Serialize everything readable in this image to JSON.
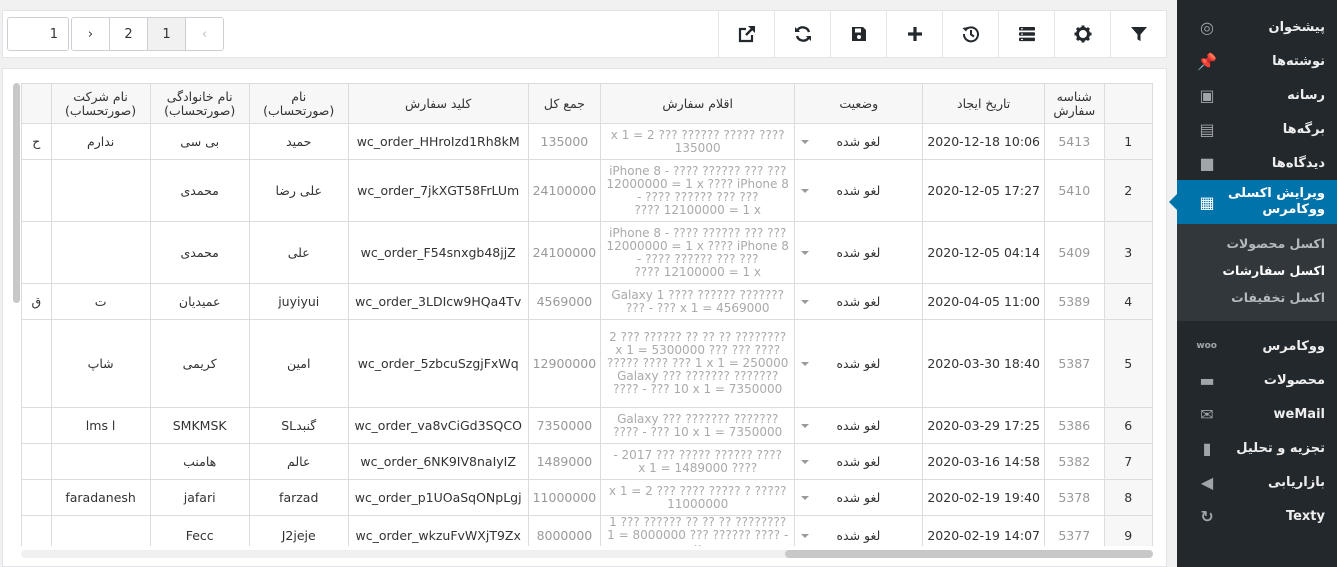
{
  "sidebar": {
    "items": [
      {
        "label": "پیشخوان",
        "icon": "dashboard-icon",
        "glyph": "◎"
      },
      {
        "label": "نوشته‌ها",
        "icon": "pin-icon",
        "glyph": "📌"
      },
      {
        "label": "رسانه",
        "icon": "media-icon",
        "glyph": "▣"
      },
      {
        "label": "برگه‌ها",
        "icon": "pages-icon",
        "glyph": "▤"
      },
      {
        "label": "دیدگاه‌ها",
        "icon": "comments-icon",
        "glyph": "■"
      },
      {
        "label": "ویرایش اکسلی ووکامرس",
        "icon": "document-icon",
        "glyph": "▦"
      }
    ],
    "submenu": [
      "اکسل محصولات",
      "اکسل سفارشات",
      "اکسل تخفیفات"
    ],
    "items2": [
      {
        "label": "ووکامرس",
        "icon": "woo-icon",
        "glyph": "woo"
      },
      {
        "label": "محصولات",
        "icon": "archive-icon",
        "glyph": "▬"
      },
      {
        "label": "weMail",
        "icon": "mail-icon",
        "glyph": "✉"
      },
      {
        "label": "تجزیه و تحلیل",
        "icon": "chart-icon",
        "glyph": "▮"
      },
      {
        "label": "بازاریابی",
        "icon": "megaphone-icon",
        "glyph": "◀"
      },
      {
        "label": "Texty",
        "icon": "texty-icon",
        "glyph": "↻"
      }
    ]
  },
  "pager": {
    "page_input": "1",
    "prev": "‹",
    "pages": [
      "1",
      "2"
    ],
    "next": "›"
  },
  "table": {
    "headers": [
      "",
      "شناسه سفارش",
      "تاریخ ایجاد",
      "وضعیت",
      "اقلام سفارش",
      "جمع کل",
      "کلید سفارش",
      "نام (صورتحساب)",
      "نام خانوادگی (صورتحساب)",
      "نام شرکت (صورتحساب)",
      ""
    ],
    "rows": [
      {
        "n": "1",
        "id": "5413",
        "date": "2020-12-18 10:06",
        "status": "لغو شده",
        "items": "???? ????? ?????? ??? 2 = 1 x 135000",
        "total": "135000",
        "key": "wc_order_HHroIzd1Rh8kM",
        "first": "حمید",
        "last": "بی سی",
        "company": "ندارم",
        "extra": "ح"
      },
      {
        "n": "2",
        "id": "5410",
        "date": "2020-12-05 17:27",
        "status": "لغو شده",
        "items": "iPhone 8 - ???? ?????? ??? ??? 12000000 = 1 x ???? iPhone 8 - ???? ?????? ??? ??? 12100000 = 1 x ????",
        "total": "24100000",
        "key": "wc_order_7jkXGT58FrLUm",
        "first": "علی رضا",
        "last": "محمدی",
        "company": "",
        "extra": ""
      },
      {
        "n": "3",
        "id": "5409",
        "date": "2020-12-05 04:14",
        "status": "لغو شده",
        "items": "iPhone 8 - ???? ?????? ??? ??? 12000000 = 1 x ???? iPhone 8 - ???? ?????? ??? ??? 12100000 = 1 x ????",
        "total": "24100000",
        "key": "wc_order_F54snxgb48jjZ",
        "first": "علی",
        "last": "محمدی",
        "company": "",
        "extra": ""
      },
      {
        "n": "4",
        "id": "5389",
        "date": "2020-04-05 11:00",
        "status": "لغو شده",
        "items": "Galaxy 1 ???? ?????? ??????? ??? - ??? x 1 = 4569000",
        "total": "4569000",
        "key": "wc_order_3LDIcw9HQa4Tv",
        "first": "juyiyui",
        "last": "عمیدیان",
        "company": "ت",
        "extra": "ق"
      },
      {
        "n": "5",
        "id": "5387",
        "date": "2020-03-30 18:40",
        "status": "لغو شده",
        "items": "???????? ?? ?? ?? ?????? ??? 2 x 1 = 5300000 ??? ??? ???? ????? ???? ??? 1 x 1 = 250000 Galaxy ??? ??????? ??????? ???? - ??? 10 x 1 = 7350000",
        "total": "12900000",
        "key": "wc_order_5zbcuSzgjFxWq",
        "first": "امین",
        "last": "کریمی",
        "company": "شاپ",
        "extra": ""
      },
      {
        "n": "6",
        "id": "5386",
        "date": "2020-03-29 17:25",
        "status": "لغو شده",
        "items": "Galaxy ??? ??????? ??????? ???? - ??? 10 x 1 = 7350000",
        "total": "7350000",
        "key": "wc_order_va8vCiGd3SQCO",
        "first": "گنبدSL",
        "last": "SMKMSK",
        "company": "lms l",
        "extra": ""
      },
      {
        "n": "7",
        "id": "5382",
        "date": "2020-03-16 14:58",
        "status": "لغو شده",
        "items": "???? ?????? ????? ??? 2017 - ???? x 1 = 1489000",
        "total": "1489000",
        "key": "wc_order_6NK9IV8naIyIZ",
        "first": "عالم",
        "last": "هامنب",
        "company": "",
        "extra": ""
      },
      {
        "n": "8",
        "id": "5378",
        "date": "2020-02-19 19:40",
        "status": "لغو شده",
        "items": "????? ? ????? ???? ??? 2 = 1 x 11000000",
        "total": "11000000",
        "key": "wc_order_p1UOaSqONpLgj",
        "first": "farzad",
        "last": "jafari",
        "company": "faradanesh",
        "extra": ""
      },
      {
        "n": "9",
        "id": "5377",
        "date": "2020-02-19 14:07",
        "status": "لغو شده",
        "items": "???????? ?? ?? ?? ?????? ??? 1 - ???? ?????? ??? 8000000 = 1 x",
        "total": "8000000",
        "key": "wc_order_wkzuFvWXjT9Zx",
        "first": "J2jeje",
        "last": "Fecc",
        "company": "",
        "extra": ""
      }
    ]
  }
}
